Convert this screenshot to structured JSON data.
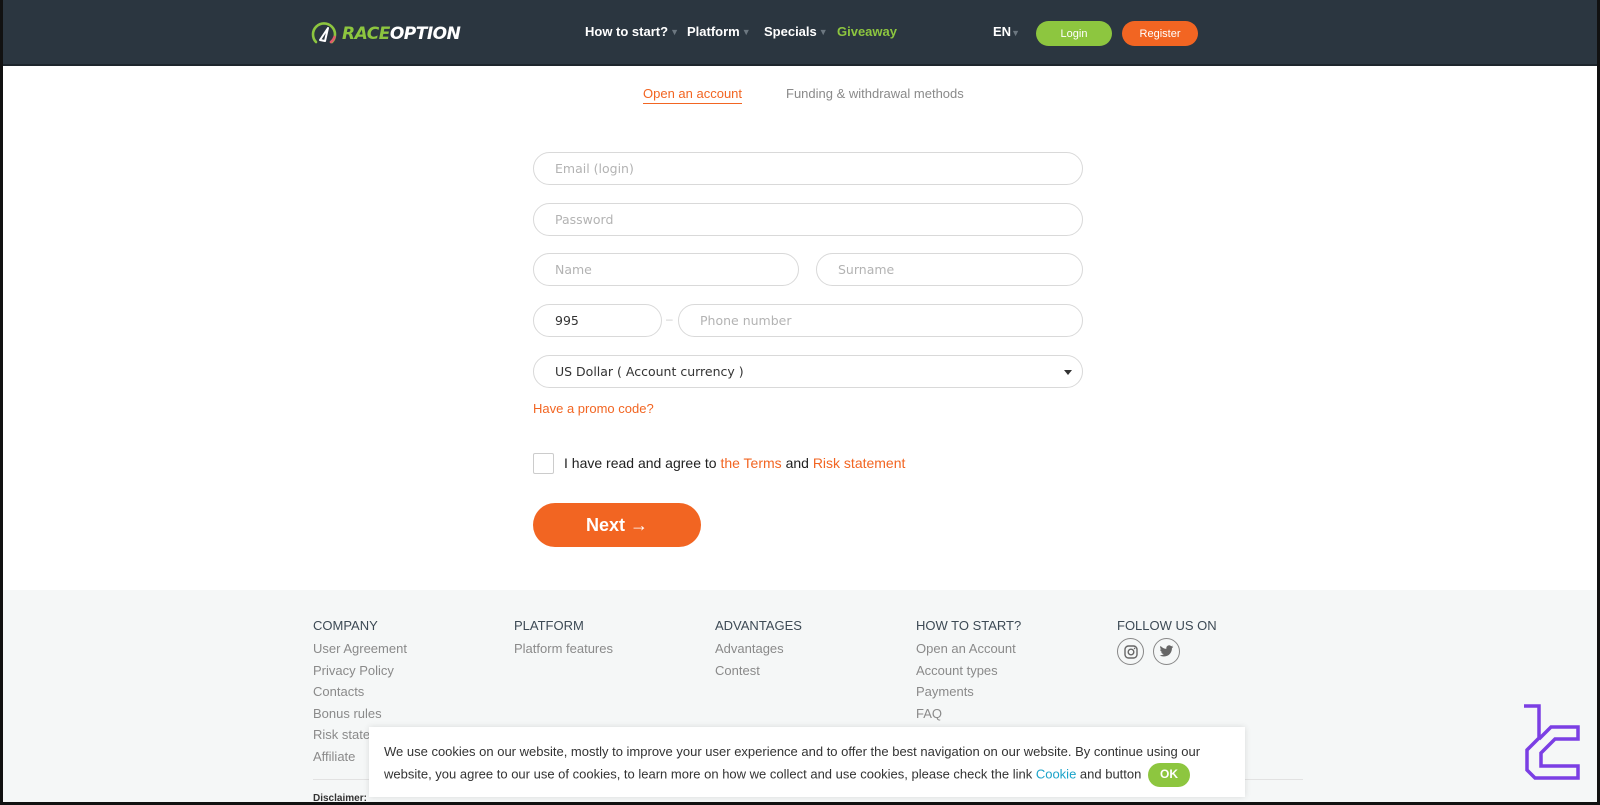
{
  "header": {
    "logo": {
      "part1": "RACE",
      "part2": "OPTION"
    },
    "nav": [
      {
        "label": "How to start?",
        "has_dropdown": true
      },
      {
        "label": "Platform",
        "has_dropdown": true
      },
      {
        "label": "Specials",
        "has_dropdown": true
      },
      {
        "label": "Giveaway",
        "has_dropdown": false
      }
    ],
    "language": "EN",
    "login_label": "Login",
    "register_label": "Register"
  },
  "tabs": {
    "active": "Open an account",
    "inactive": "Funding & withdrawal methods"
  },
  "form": {
    "email_placeholder": "Email (login)",
    "password_placeholder": "Password",
    "name_placeholder": "Name",
    "surname_placeholder": "Surname",
    "phone_code_value": "995",
    "phone_placeholder": "Phone number",
    "currency_selected": "US Dollar ( Account currency )",
    "promo_link": "Have a promo code?",
    "agree_text": "I have read and agree to",
    "terms_link": "the Terms",
    "and_text": "and",
    "risk_link": "Risk statement",
    "next_label": "Next →"
  },
  "footer": {
    "columns": [
      {
        "title": "COMPANY",
        "links": [
          "User Agreement",
          "Privacy Policy",
          "Contacts",
          "Bonus rules",
          "Risk statement",
          "Affiliate"
        ]
      },
      {
        "title": "PLATFORM",
        "links": [
          "Platform features"
        ]
      },
      {
        "title": "ADVANTAGES",
        "links": [
          "Advantages",
          "Contest"
        ]
      },
      {
        "title": "HOW TO START?",
        "links": [
          "Open an Account",
          "Account types",
          "Payments",
          "FAQ"
        ]
      },
      {
        "title": "FOLLOW US ON",
        "links": []
      }
    ],
    "social": [
      "instagram-icon",
      "twitter-icon"
    ],
    "disclaimer_label": "Disclaimer:"
  },
  "cookie": {
    "text1": "We use cookies on our website, mostly to improve your user experience and to offer the best navigation on our website. By continue using our website, you agree to our use of cookies, to learn more on how we collect and use cookies, please check the link",
    "link": "Cookie",
    "text2": "and button",
    "ok_label": "OK"
  },
  "colors": {
    "header_bg": "#2b3640",
    "accent_orange": "#f26522",
    "accent_green": "#8dc63f",
    "cookie_link": "#1aa3c9",
    "watermark": "#7b3fe4"
  }
}
